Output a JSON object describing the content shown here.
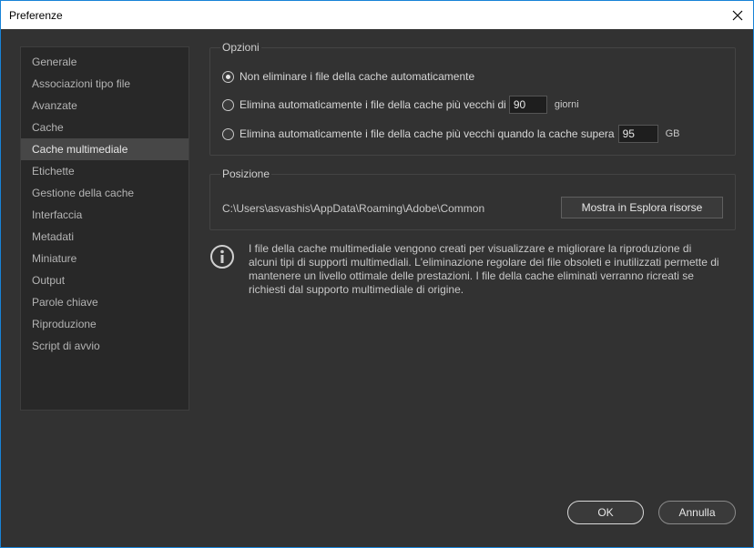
{
  "window": {
    "title": "Preferenze",
    "close_icon": "close-icon"
  },
  "sidebar": {
    "items": [
      {
        "label": "Generale",
        "active": false
      },
      {
        "label": "Associazioni tipo file",
        "active": false
      },
      {
        "label": "Avanzate",
        "active": false
      },
      {
        "label": "Cache",
        "active": false
      },
      {
        "label": "Cache multimediale",
        "active": true
      },
      {
        "label": "Etichette",
        "active": false
      },
      {
        "label": "Gestione della cache",
        "active": false
      },
      {
        "label": "Interfaccia",
        "active": false
      },
      {
        "label": "Metadati",
        "active": false
      },
      {
        "label": "Miniature",
        "active": false
      },
      {
        "label": "Output",
        "active": false
      },
      {
        "label": "Parole chiave",
        "active": false
      },
      {
        "label": "Riproduzione",
        "active": false
      },
      {
        "label": "Script di avvio",
        "active": false
      }
    ]
  },
  "options": {
    "title": "Opzioni",
    "radio1_label": "Non eliminare i file della cache automaticamente",
    "radio2_label": "Elimina automaticamente i file della cache più vecchi di",
    "radio2_value": "90",
    "radio2_unit": "giorni",
    "radio3_label": "Elimina automaticamente i file della cache più vecchi quando la cache supera",
    "radio3_value": "95",
    "radio3_unit": "GB",
    "selected": 1
  },
  "position": {
    "title": "Posizione",
    "path": "C:\\Users\\asvashis\\AppData\\Roaming\\Adobe\\Common",
    "show_button": "Mostra in Esplora risorse"
  },
  "info": {
    "icon": "info-icon",
    "text": "I file della cache multimediale vengono creati per visualizzare e migliorare la riproduzione di alcuni tipi di supporti multimediali. L'eliminazione regolare dei file obsoleti e inutilizzati permette di mantenere un livello ottimale delle prestazioni. I file della cache eliminati verranno ricreati se richiesti dal supporto multimediale di origine."
  },
  "footer": {
    "ok_label": "OK",
    "cancel_label": "Annulla"
  },
  "colors": {
    "background": "#323232",
    "sidebar_bg": "#282828",
    "selected_item": "#474747",
    "window_border": "#1883d7"
  }
}
